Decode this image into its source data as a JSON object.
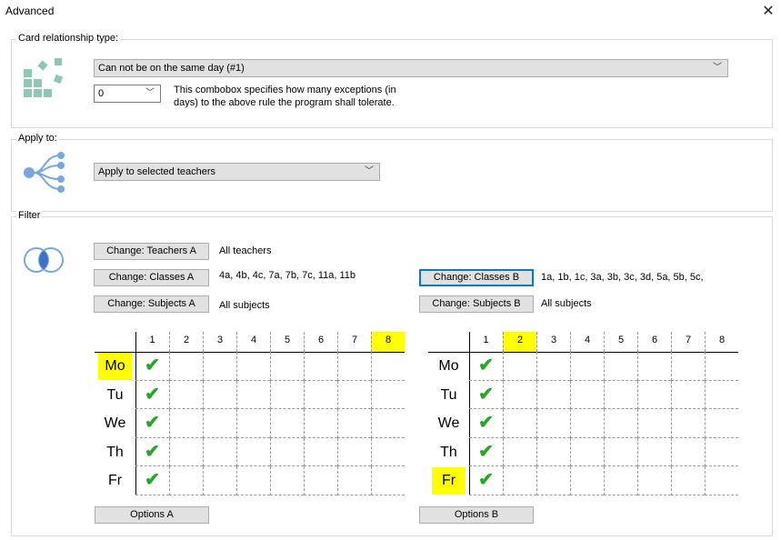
{
  "window": {
    "title": "Advanced",
    "close_icon": "close-icon"
  },
  "card_relationship": {
    "label": "Card relationship type:",
    "type_value": "Can not be on the same day (#1)",
    "exceptions_value": "0",
    "exceptions_desc_line1": "This combobox specifies how many exceptions (in",
    "exceptions_desc_line2": "days) to the above rule the program shall tolerate."
  },
  "apply_to": {
    "label": "Apply to:",
    "value": "Apply to selected teachers"
  },
  "filter": {
    "label": "Filter",
    "a": {
      "teachers_btn": "Change: Teachers A",
      "teachers_val": "All teachers",
      "classes_btn": "Change: Classes A",
      "classes_val": "4a, 4b, 4c, 7a, 7b, 7c, 11a, 11b",
      "subjects_btn": "Change: Subjects A",
      "subjects_val": "All subjects",
      "options_btn": "Options A"
    },
    "b": {
      "classes_btn": "Change: Classes B",
      "classes_val": "1a, 1b, 1c, 3a, 3b, 3c, 3d, 5a, 5b, 5c,",
      "subjects_btn": "Change: Subjects B",
      "subjects_val": "All subjects",
      "options_btn": "Options B"
    }
  },
  "grid": {
    "periods": [
      "1",
      "2",
      "3",
      "4",
      "5",
      "6",
      "7",
      "8"
    ],
    "days": [
      "Mo",
      "Tu",
      "We",
      "Th",
      "Fr"
    ],
    "a": {
      "highlight_period": "8",
      "highlight_day": "Mo",
      "checked_period": "1"
    },
    "b": {
      "highlight_period": "2",
      "highlight_day": "Fr",
      "checked_period": "1"
    },
    "check_symbol": "✔"
  },
  "colors": {
    "highlight": "#ffff00",
    "check": "#2aa52a",
    "focus": "#0078d7"
  }
}
